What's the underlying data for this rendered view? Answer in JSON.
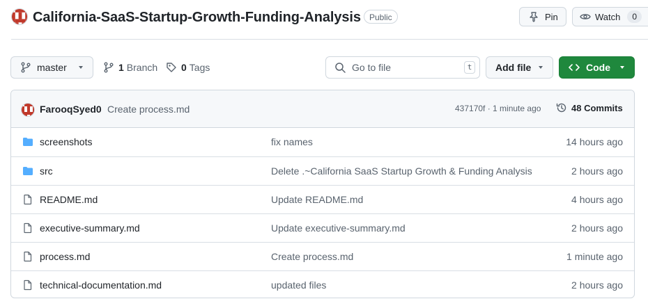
{
  "repo": {
    "name": "California-SaaS-Startup-Growth-Funding-Analysis",
    "visibility": "Public"
  },
  "actions": {
    "pin_label": "Pin",
    "watch_label": "Watch",
    "watch_count": "0"
  },
  "toolbar": {
    "branch_name": "master",
    "branch_count": "1",
    "branch_label": "Branch",
    "tag_count": "0",
    "tag_label": "Tags",
    "search_placeholder": "Go to file",
    "search_shortcut": "t",
    "add_file_label": "Add file",
    "code_label": "Code"
  },
  "latest_commit": {
    "author": "FarooqSyed0",
    "message": "Create process.md",
    "hash_time": "437170f · 1 minute ago",
    "commits_label": "48 Commits"
  },
  "files": [
    {
      "type": "folder",
      "name": "screenshots",
      "message": "fix names",
      "age": "14 hours ago"
    },
    {
      "type": "folder",
      "name": "src",
      "message": "Delete .~California SaaS Startup Growth & Funding Analysis",
      "age": "2 hours ago"
    },
    {
      "type": "file",
      "name": "README.md",
      "message": "Update README.md",
      "age": "4 hours ago"
    },
    {
      "type": "file",
      "name": "executive-summary.md",
      "message": "Update executive-summary.md",
      "age": "2 hours ago"
    },
    {
      "type": "file",
      "name": "process.md",
      "message": "Create process.md",
      "age": "1 minute ago"
    },
    {
      "type": "file",
      "name": "technical-documentation.md",
      "message": "updated files",
      "age": "2 hours ago"
    }
  ],
  "colors": {
    "accent_green": "#1f883d",
    "folder_blue": "#54aeff",
    "muted_text": "#59636e",
    "border": "#d0d7de"
  },
  "icons": [
    "identicon-avatar",
    "pin-icon",
    "eye-icon",
    "branch-icon",
    "tag-icon",
    "search-icon",
    "code-icon",
    "history-icon",
    "folder-icon",
    "file-icon",
    "triangle-down-icon"
  ]
}
